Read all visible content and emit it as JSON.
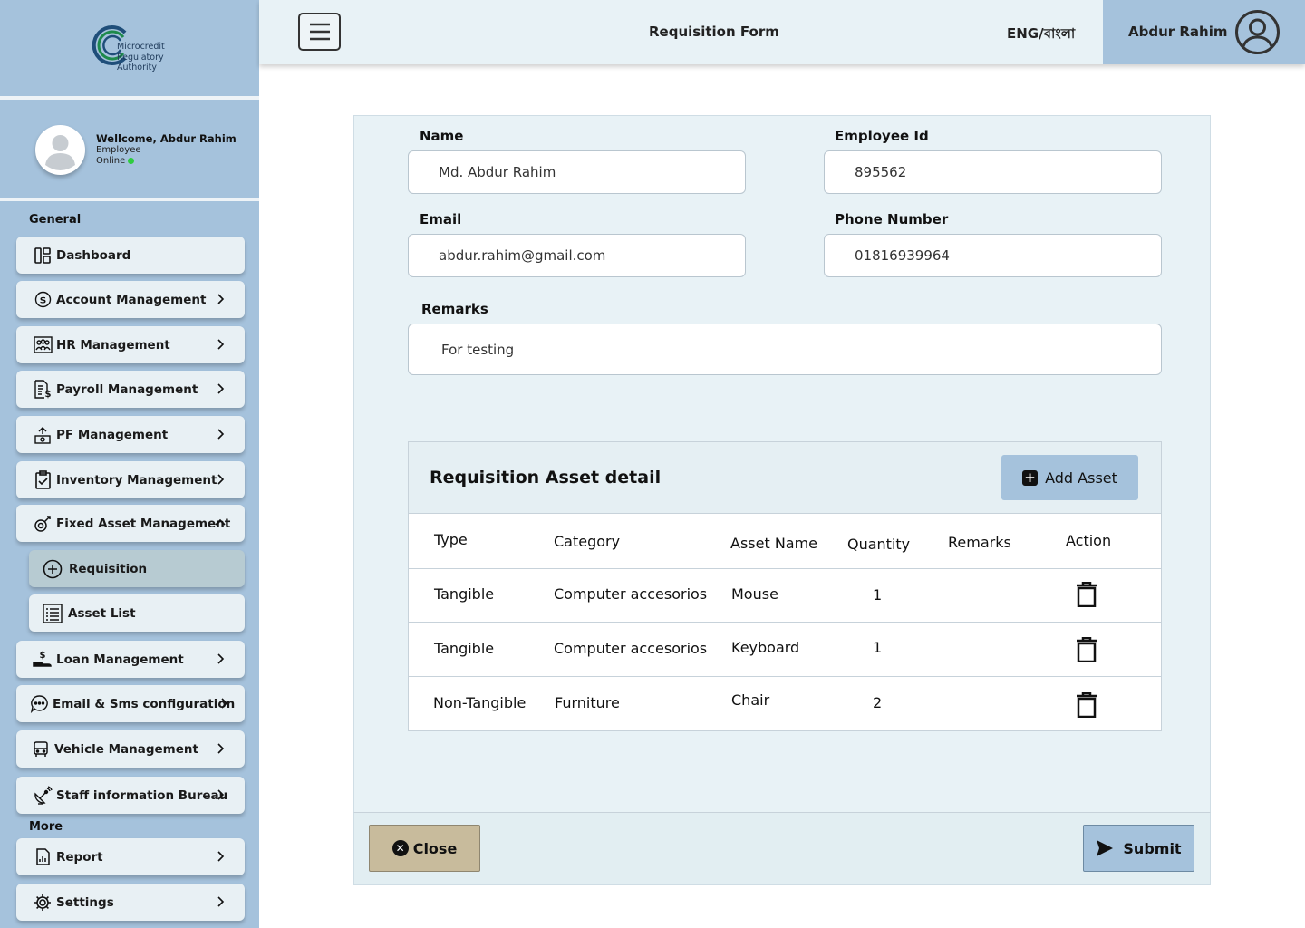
{
  "brand": {
    "logo_lines": [
      "Microcredit",
      "Regulatory",
      "Authority"
    ]
  },
  "profile": {
    "welcome": "Wellcome, Abdur Rahim",
    "role": "Employee",
    "status": "Online"
  },
  "sidebar": {
    "general_label": "General",
    "more_label": "More",
    "items": [
      {
        "label": "Dashboard",
        "icon": "dashboard-icon"
      },
      {
        "label": "Account Management",
        "icon": "dollar-circle-icon"
      },
      {
        "label": "HR Management",
        "icon": "people-icon"
      },
      {
        "label": "Payroll Management",
        "icon": "payroll-document-icon"
      },
      {
        "label": "PF Management",
        "icon": "money-transfer-icon"
      },
      {
        "label": "Inventory Management",
        "icon": "clipboard-check-icon"
      },
      {
        "label": "Fixed Asset Management",
        "icon": "asset-icon"
      },
      {
        "label": "Requisition",
        "icon": "plus-circle-icon"
      },
      {
        "label": "Asset List",
        "icon": "list-icon"
      },
      {
        "label": "Loan Management",
        "icon": "hand-money-icon"
      },
      {
        "label": "Email & Sms configuration",
        "icon": "chat-icon"
      },
      {
        "label": "Vehicle Management",
        "icon": "bus-icon"
      },
      {
        "label": "Staff information Bureau",
        "icon": "satellite-icon"
      },
      {
        "label": "Report",
        "icon": "report-icon"
      },
      {
        "label": "Settings",
        "icon": "gear-icon"
      }
    ]
  },
  "header": {
    "title": "Requisition Form",
    "language": "ENG/বাংলা",
    "user_name": "Abdur Rahim"
  },
  "form": {
    "name_label": "Name",
    "name_value": "Md. Abdur Rahim",
    "employee_id_label": "Employee Id",
    "employee_id_value": "895562",
    "email_label": "Email",
    "email_value": "abdur.rahim@gmail.com",
    "phone_label": "Phone Number",
    "phone_value": "01816939964",
    "remarks_label": "Remarks",
    "remarks_value": "For testing"
  },
  "assets": {
    "title": "Requisition Asset detail",
    "add_button": "Add Asset",
    "columns": [
      "Type",
      "Category",
      "Asset Name",
      "Quantity",
      "Remarks",
      "Action"
    ],
    "rows": [
      {
        "type": "Tangible",
        "category": "Computer accesorios",
        "asset_name": "Mouse",
        "quantity": "1",
        "remarks": ""
      },
      {
        "type": "Tangible",
        "category": "Computer accesorios",
        "asset_name": "Keyboard",
        "quantity": "1",
        "remarks": ""
      },
      {
        "type": "Non-Tangible",
        "category": "Furniture",
        "asset_name": "Chair",
        "quantity": "2",
        "remarks": ""
      }
    ]
  },
  "footer": {
    "close_label": "Close",
    "submit_label": "Submit"
  }
}
